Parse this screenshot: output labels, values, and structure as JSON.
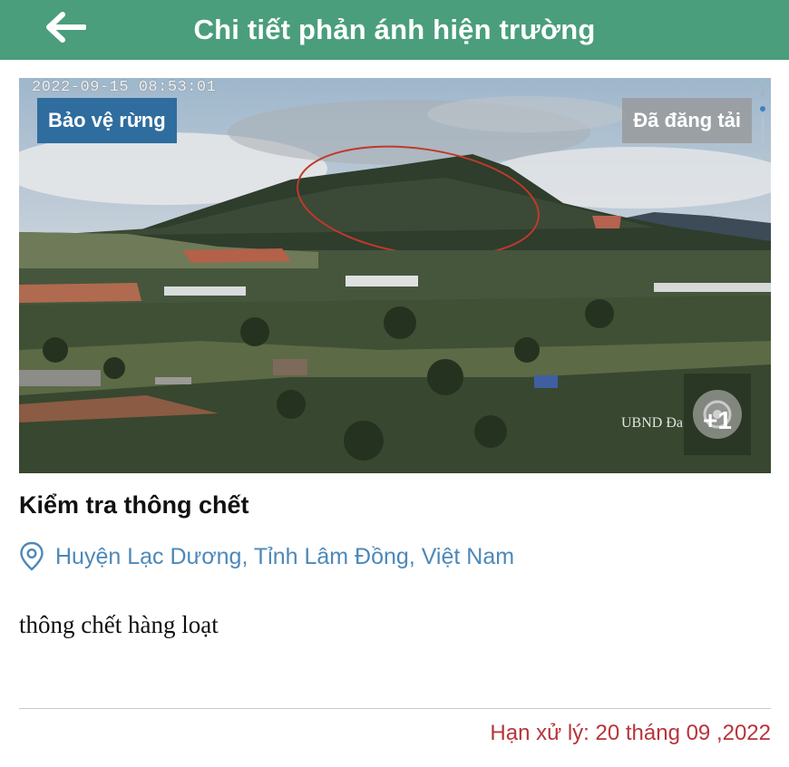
{
  "header": {
    "title": "Chi tiết phản ánh hiện trường",
    "back_icon": "arrow-left-icon",
    "background": "#4a9e7b"
  },
  "photo": {
    "timestamp": "2022-09-15 08:53:01",
    "category_badge": "Bảo vệ rừng",
    "status_badge": "Đã đăng tải",
    "watermark": "UBND Đa",
    "more_count": "+1",
    "more_icon": "camera-lens-icon"
  },
  "report": {
    "title": "Kiểm tra thông chết",
    "location_icon": "map-pin-icon",
    "location": "Huyện Lạc Dương, Tỉnh Lâm Đồng, Việt Nam",
    "description": "thông chết hàng loạt",
    "deadline": "Hạn xử lý: 20 tháng 09 ,2022"
  },
  "colors": {
    "accent": "#4a9e7b",
    "category_badge": "#2f6d9f",
    "location_text": "#4d88b8",
    "deadline_text": "#b8343b"
  }
}
